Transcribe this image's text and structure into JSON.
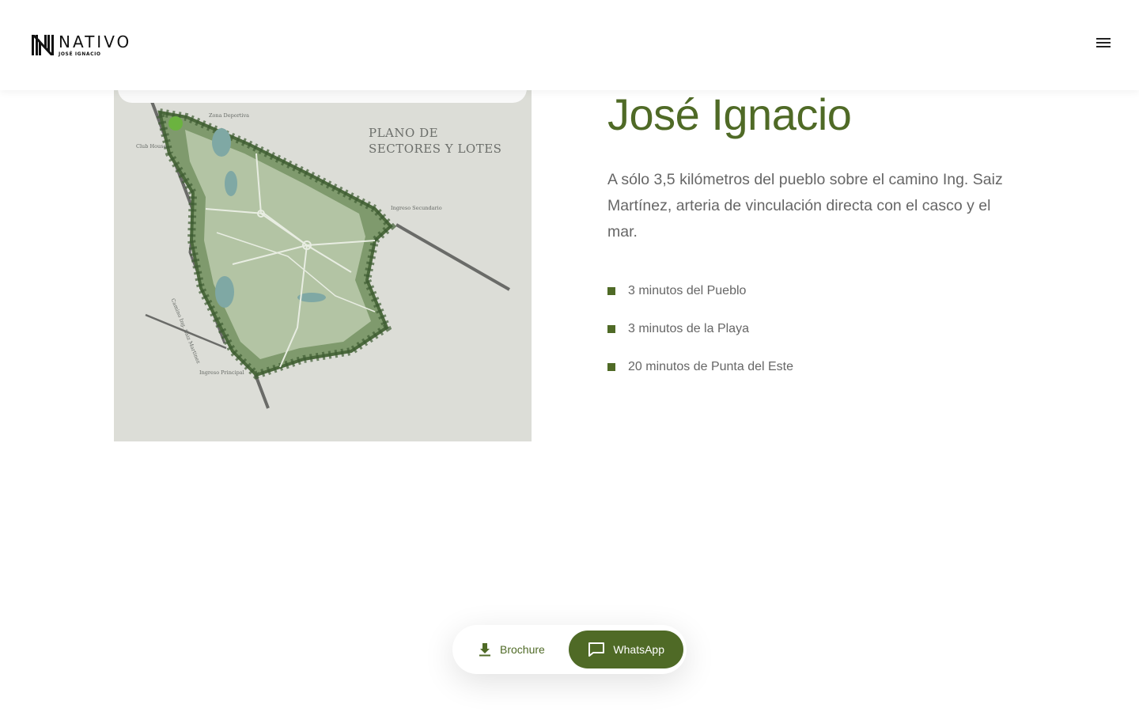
{
  "header": {
    "logo_name": "NATIVO",
    "logo_sub": "JOSÉ IGNACIO",
    "menu_icon": "menu-icon"
  },
  "plan": {
    "title": "PLANO DE\nSECTORES Y LOTES",
    "labels": {
      "zona_deportiva": "Zona Deportiva",
      "club_house": "Club House",
      "ingreso_secundario": "Ingreso Secundario",
      "ingreso_principal": "Ingreso Principal",
      "camino": "Camino Ing. Saiz Martinez"
    }
  },
  "content": {
    "title": "José Ignacio",
    "description": "A sólo 3,5 kilómetros del pueblo sobre el camino Ing. Saiz Martínez, arteria de vinculación directa con el casco y el mar.",
    "features": [
      "3 minutos del Pueblo",
      "3 minutos de la Playa",
      "20 minutos de Punta del Este"
    ]
  },
  "actions": {
    "brochure_label": "Brochure",
    "brochure_icon": "download-icon",
    "whatsapp_label": "WhatsApp",
    "whatsapp_icon": "chat-icon"
  },
  "colors": {
    "accent": "#4f6a26",
    "text": "#666666",
    "plan_background": "#dcddd7"
  }
}
